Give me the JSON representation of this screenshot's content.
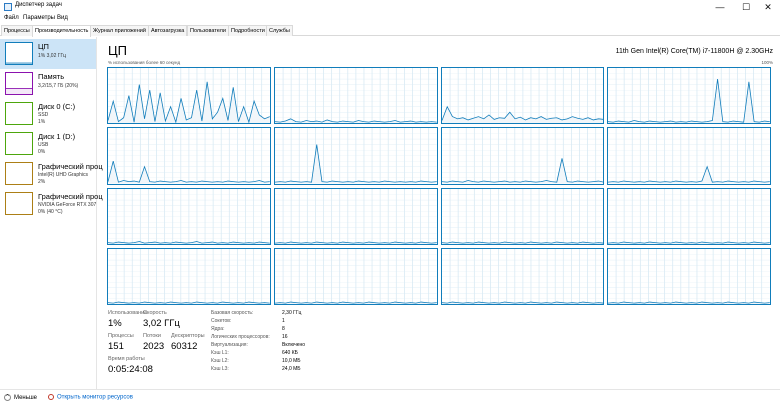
{
  "window": {
    "title": "Диспетчер задач",
    "controls": {
      "minimize": "—",
      "maximize": "☐",
      "close": "✕"
    }
  },
  "menu": [
    "Файл",
    "Параметры",
    "Вид"
  ],
  "tabs": [
    "Процессы",
    "Производительность",
    "Журнал приложений",
    "Автозагрузка",
    "Пользователи",
    "Подробности",
    "Службы"
  ],
  "active_tab": "Производительность",
  "colors": {
    "cpu": "#117dbb",
    "cpu_fill": "#f1f6fa",
    "memory": "#8b12ae",
    "disk": "#4da60c",
    "gpu": "#ac7f16",
    "selected": "#cce4f7"
  },
  "sidebar": [
    {
      "name": "ЦП",
      "sub1": "1% 3,02 ГГц",
      "sub2": "",
      "color_key": "cpu",
      "icon": "cpu-graph-icon"
    },
    {
      "name": "Память",
      "sub1": "3,2/15,7 ГБ (20%)",
      "sub2": "",
      "color_key": "memory",
      "icon": "memory-graph-icon"
    },
    {
      "name": "Диск 0 (C:)",
      "sub1": "SSD",
      "sub2": "1%",
      "color_key": "disk",
      "icon": "disk-graph-icon"
    },
    {
      "name": "Диск 1 (D:)",
      "sub1": "USB",
      "sub2": "0%",
      "color_key": "disk",
      "icon": "disk-graph-icon"
    },
    {
      "name": "Графический проц",
      "sub1": "Intel(R) UHD Graphics",
      "sub2": "2%",
      "color_key": "gpu",
      "icon": "gpu-graph-icon"
    },
    {
      "name": "Графический проц",
      "sub1": "NVIDIA GeForce RTX 307",
      "sub2": "0% (40 °C)",
      "color_key": "gpu",
      "icon": "gpu-graph-icon"
    }
  ],
  "main": {
    "title": "ЦП",
    "cpu_model": "11th Gen Intel(R) Core(TM) i7-11800H @ 2.30GHz",
    "util_label": "% использования более 60 секунд",
    "util_max": "100%"
  },
  "cpu_history": [
    [
      5,
      40,
      3,
      10,
      50,
      2,
      70,
      8,
      60,
      3,
      55,
      4,
      30,
      2,
      45,
      6,
      10,
      60,
      4,
      75,
      8,
      20,
      45,
      5,
      65,
      3,
      30,
      2,
      40,
      15,
      8,
      12
    ],
    [
      3,
      2,
      4,
      8,
      3,
      2,
      5,
      3,
      4,
      2,
      6,
      3,
      2,
      4,
      3,
      2,
      5,
      3,
      2,
      4,
      3,
      2,
      3,
      5,
      2,
      3,
      4,
      2,
      3,
      2,
      3,
      2
    ],
    [
      5,
      30,
      12,
      8,
      10,
      6,
      9,
      12,
      8,
      15,
      7,
      10,
      9,
      20,
      8,
      11,
      6,
      10,
      8,
      12,
      7,
      9,
      10,
      6,
      8,
      12,
      9,
      7,
      10,
      6,
      8,
      7
    ],
    [
      3,
      2,
      4,
      3,
      2,
      5,
      3,
      2,
      4,
      3,
      2,
      3,
      4,
      2,
      3,
      2,
      4,
      3,
      2,
      3,
      5,
      80,
      3,
      2,
      4,
      3,
      2,
      75,
      3,
      2,
      4,
      3
    ],
    [
      3,
      40,
      2,
      5,
      3,
      4,
      2,
      30,
      3,
      2,
      4,
      3,
      2,
      3,
      5,
      2,
      3,
      2,
      4,
      3,
      2,
      3,
      2,
      4,
      3,
      2,
      3,
      2,
      3,
      5,
      2,
      3
    ],
    [
      2,
      3,
      2,
      4,
      3,
      2,
      3,
      2,
      70,
      3,
      2,
      4,
      3,
      2,
      3,
      2,
      4,
      3,
      2,
      3,
      2,
      4,
      3,
      2,
      3,
      2,
      3,
      2,
      4,
      3,
      2,
      3
    ],
    [
      3,
      2,
      4,
      3,
      2,
      5,
      3,
      2,
      4,
      3,
      2,
      3,
      4,
      2,
      3,
      2,
      4,
      3,
      2,
      3,
      5,
      3,
      2,
      45,
      3,
      2,
      4,
      3,
      2,
      3,
      4,
      2
    ],
    [
      2,
      3,
      2,
      4,
      3,
      2,
      3,
      2,
      4,
      3,
      2,
      3,
      2,
      4,
      3,
      2,
      3,
      2,
      4,
      30,
      2,
      3,
      2,
      4,
      3,
      2,
      3,
      2,
      4,
      3,
      2,
      3
    ],
    [
      3,
      2,
      4,
      3,
      2,
      3,
      5,
      2,
      3,
      4,
      2,
      3,
      2,
      4,
      3,
      2,
      3,
      5,
      2,
      3,
      4,
      2,
      3,
      2,
      4,
      3,
      2,
      3,
      2,
      4,
      3,
      2
    ],
    [
      2,
      3,
      2,
      4,
      3,
      2,
      3,
      2,
      4,
      3,
      2,
      3,
      2,
      4,
      3,
      2,
      3,
      2,
      4,
      3,
      2,
      3,
      2,
      4,
      3,
      2,
      3,
      2,
      4,
      3,
      2,
      3
    ],
    [
      3,
      2,
      4,
      3,
      2,
      3,
      2,
      4,
      3,
      2,
      3,
      2,
      4,
      3,
      2,
      3,
      2,
      4,
      3,
      2,
      3,
      2,
      4,
      3,
      2,
      3,
      2,
      4,
      3,
      2,
      3,
      2
    ],
    [
      2,
      3,
      2,
      4,
      3,
      2,
      3,
      2,
      4,
      3,
      2,
      3,
      2,
      4,
      3,
      2,
      3,
      2,
      4,
      3,
      2,
      3,
      2,
      4,
      3,
      2,
      3,
      2,
      4,
      3,
      2,
      3
    ],
    [
      3,
      2,
      4,
      3,
      2,
      3,
      2,
      4,
      3,
      2,
      3,
      2,
      4,
      3,
      2,
      3,
      2,
      4,
      3,
      2,
      3,
      2,
      4,
      3,
      2,
      3,
      2,
      4,
      3,
      2,
      3,
      2
    ],
    [
      2,
      3,
      2,
      4,
      3,
      2,
      3,
      2,
      4,
      3,
      2,
      3,
      2,
      4,
      3,
      2,
      3,
      2,
      4,
      3,
      2,
      3,
      2,
      4,
      3,
      2,
      3,
      2,
      4,
      3,
      2,
      3
    ],
    [
      3,
      2,
      4,
      3,
      2,
      3,
      2,
      4,
      3,
      2,
      3,
      2,
      4,
      3,
      2,
      3,
      2,
      4,
      3,
      2,
      3,
      2,
      4,
      3,
      2,
      3,
      2,
      4,
      3,
      2,
      3,
      2
    ],
    [
      2,
      3,
      2,
      4,
      3,
      2,
      3,
      2,
      4,
      3,
      2,
      3,
      2,
      4,
      3,
      2,
      3,
      2,
      4,
      3,
      2,
      3,
      2,
      4,
      3,
      2,
      3,
      2,
      4,
      3,
      2,
      3
    ]
  ],
  "stats": {
    "utilization_label": "Использование",
    "utilization": "1%",
    "speed_label": "Скорость",
    "speed": "3,02 ГГц",
    "processes_label": "Процессы",
    "processes": "151",
    "threads_label": "Потоки",
    "threads": "2023",
    "handles_label": "Дескрипторы",
    "handles": "60312",
    "uptime_label": "Время работы",
    "uptime": "0:05:24:08"
  },
  "specs": [
    {
      "label": "Базовая скорость:",
      "value": "2,30 ГГц"
    },
    {
      "label": "Сокетов:",
      "value": "1"
    },
    {
      "label": "Ядра:",
      "value": "8"
    },
    {
      "label": "Логических процессоров:",
      "value": "16"
    },
    {
      "label": "Виртуализация:",
      "value": "Включено"
    },
    {
      "label": "Кэш L1:",
      "value": "640 КБ"
    },
    {
      "label": "Кэш L2:",
      "value": "10,0 МБ"
    },
    {
      "label": "Кэш L3:",
      "value": "24,0 МБ"
    }
  ],
  "bottom": {
    "less": "Меньше",
    "monitor": "Открыть монитор ресурсов"
  }
}
